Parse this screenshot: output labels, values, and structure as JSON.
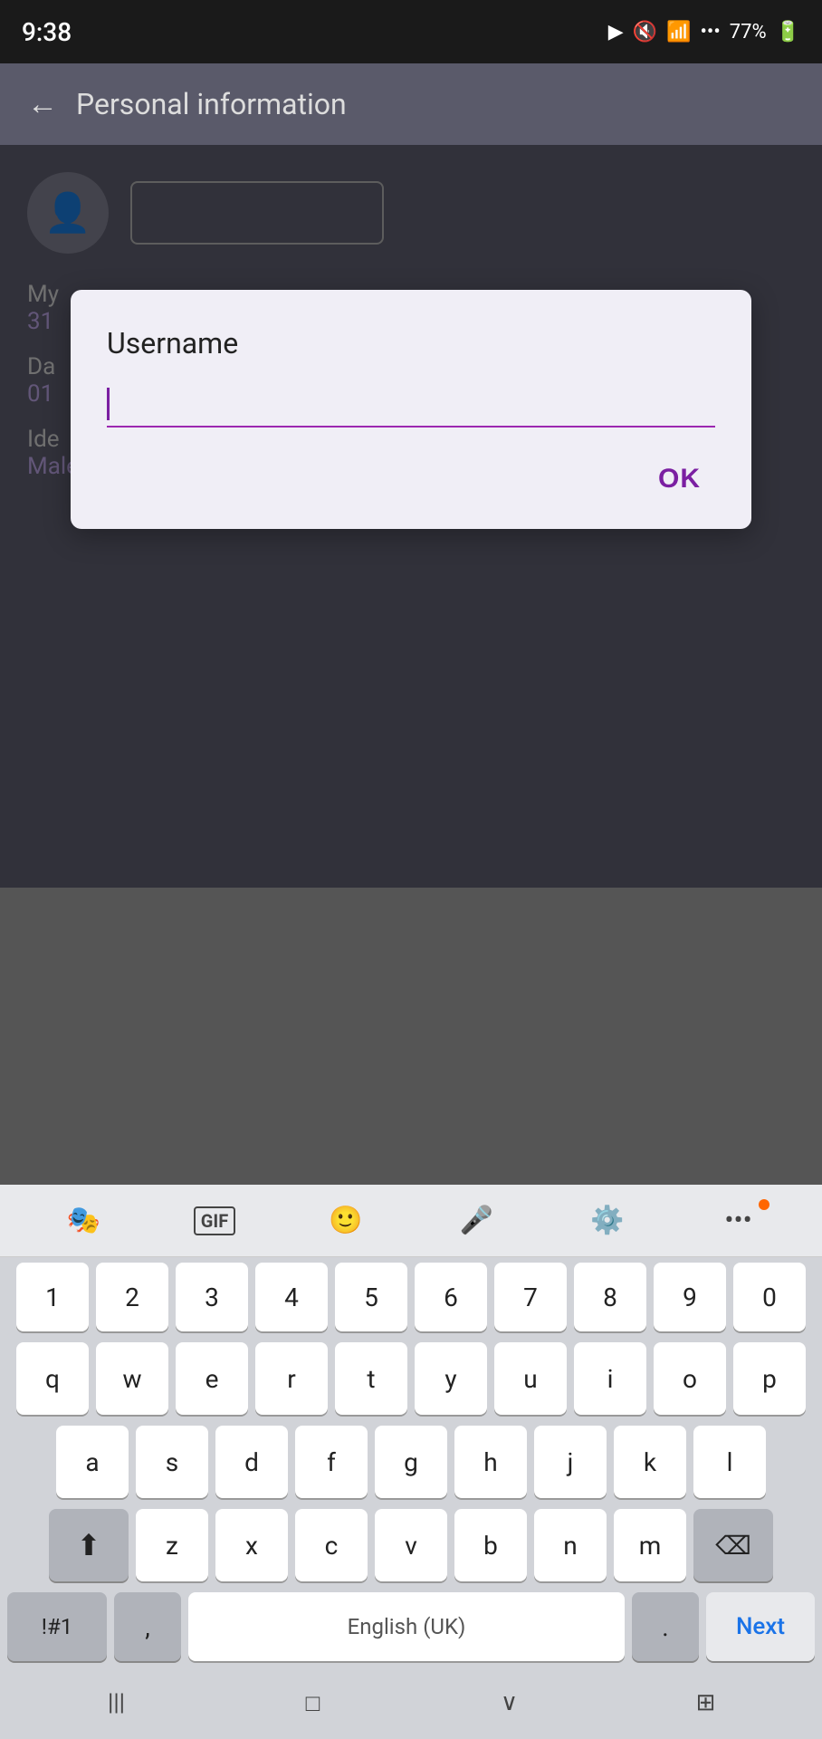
{
  "statusBar": {
    "time": "9:38",
    "battery": "77%",
    "icons": [
      "bluetooth",
      "mute",
      "wifi",
      "signal"
    ]
  },
  "header": {
    "title": "Personal information",
    "backLabel": "←"
  },
  "profile": {
    "avatarIcon": "👤",
    "myLabel": "My",
    "myValue": "31",
    "daLabel": "Da",
    "daValue": "01",
    "ideLabel": "Ide",
    "ideValue": "Male"
  },
  "dialog": {
    "title": "Username",
    "inputValue": "",
    "okLabel": "OK"
  },
  "keyboard": {
    "toolbarItems": [
      "sticker",
      "GIF",
      "emoji",
      "microphone",
      "settings",
      "more"
    ],
    "numbers": [
      "1",
      "2",
      "3",
      "4",
      "5",
      "6",
      "7",
      "8",
      "9",
      "0"
    ],
    "row1": [
      "q",
      "w",
      "e",
      "r",
      "t",
      "y",
      "u",
      "i",
      "o",
      "p"
    ],
    "row2": [
      "a",
      "s",
      "d",
      "f",
      "g",
      "h",
      "j",
      "k",
      "l"
    ],
    "row3": [
      "z",
      "x",
      "c",
      "v",
      "b",
      "n",
      "m"
    ],
    "bottomRow": {
      "symbols": "!#1",
      "comma": ",",
      "space": "English (UK)",
      "period": ".",
      "next": "Next"
    },
    "navBar": {
      "back": "|||",
      "home": "□",
      "recent": "∨",
      "keyboard": "⊞"
    }
  }
}
